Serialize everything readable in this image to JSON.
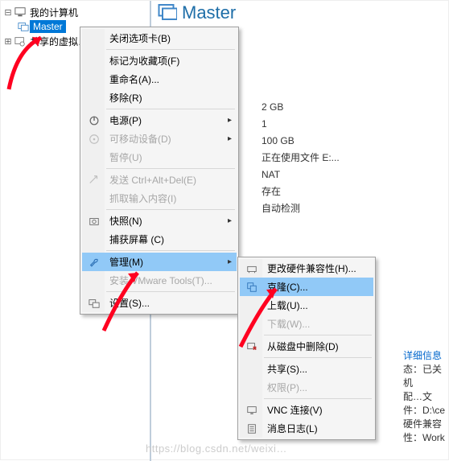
{
  "tree": {
    "root_label": "我的计算机",
    "vm_label": "Master",
    "shared_label": "共享的虚拟…"
  },
  "main": {
    "vm_title": "Master",
    "info": {
      "mem": "2 GB",
      "cpu": "1",
      "disk": "100 GB",
      "cd": "正在使用文件 E:...",
      "net": "NAT",
      "usb": "存在",
      "display": "自动检测"
    }
  },
  "footer": {
    "details": "详细信息",
    "line1": "态：已关机",
    "line2": "配…文件：D:\\ce",
    "line3": "硬件兼容性：Work"
  },
  "watermark": "https://blog.csdn.net/weixi…",
  "menu1": {
    "close_tab": "关闭选项卡(B)",
    "favorite": "标记为收藏项(F)",
    "rename": "重命名(A)...",
    "remove": "移除(R)",
    "power": "电源(P)",
    "removable": "可移动设备(D)",
    "pause": "暂停(U)",
    "send_cad": "发送 Ctrl+Alt+Del(E)",
    "grab_input": "抓取输入内容(I)",
    "snapshot": "快照(N)",
    "capture": "捕获屏幕 (C)",
    "manage": "管理(M)",
    "install_tools": "安装 VMware Tools(T)...",
    "settings": "设置(S)..."
  },
  "menu2": {
    "change_hw": "更改硬件兼容性(H)...",
    "clone": "克隆(C)...",
    "upload": "上载(U)...",
    "download": "下载(W)...",
    "delete_disk": "从磁盘中删除(D)",
    "share": "共享(S)...",
    "permissions": "权限(P)...",
    "vnc": "VNC 连接(V)",
    "msglog": "消息日志(L)"
  }
}
